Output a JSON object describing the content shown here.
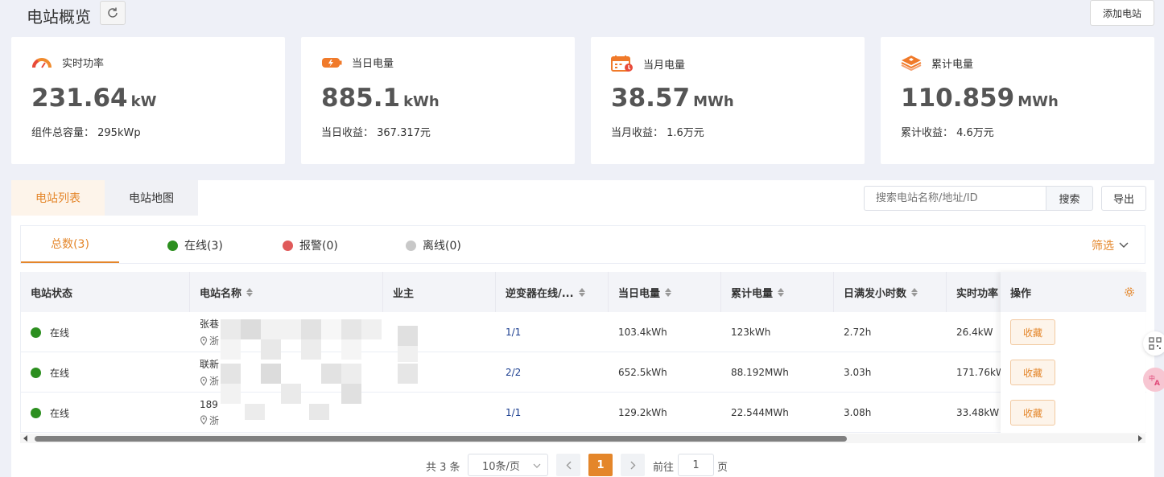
{
  "header": {
    "title": "电站概览",
    "add_station": "添加电站"
  },
  "cards": [
    {
      "label": "实时功率",
      "value": "231.64",
      "unit": "kW",
      "sub": "组件总容量： 295kWp",
      "icon": "speedometer-icon"
    },
    {
      "label": "当日电量",
      "value": "885.1",
      "unit": "kWh",
      "sub": "当日收益： 367.317元",
      "icon": "battery-bolt-icon"
    },
    {
      "label": "当月电量",
      "value": "38.57",
      "unit": "MWh",
      "sub": "当月收益： 1.6万元",
      "icon": "calendar-icon"
    },
    {
      "label": "累计电量",
      "value": "110.859",
      "unit": "MWh",
      "sub": "累计收益： 4.6万元",
      "icon": "layers-icon"
    }
  ],
  "tabs": {
    "list": "电站列表",
    "map": "电站地图"
  },
  "search": {
    "placeholder": "搜索电站名称/地址/ID",
    "button": "搜索",
    "export": "导出"
  },
  "filters": {
    "total": "总数(3)",
    "online": "在线(3)",
    "alarm": "报警(0)",
    "offline": "离线(0)",
    "screen": "筛选",
    "colors": {
      "online": "#2c8f1f",
      "alarm": "#e05a5a",
      "offline": "#c8c8c8"
    }
  },
  "table": {
    "headers": {
      "status": "电站状态",
      "name": "电站名称",
      "owner": "业主",
      "inverter": "逆变器在线/...",
      "daily": "当日电量",
      "total": "累计电量",
      "hours": "日满发小时数",
      "power": "实时功率",
      "action": "操作"
    },
    "rows": [
      {
        "status": "在线",
        "name": "张巷",
        "loc": "浙",
        "inverter": "1/1",
        "daily": "103.4kWh",
        "total": "123kWh",
        "hours": "2.72h",
        "power": "26.4kW",
        "action": "收藏"
      },
      {
        "status": "在线",
        "name": "联新",
        "loc": "浙",
        "inverter": "2/2",
        "daily": "652.5kWh",
        "total": "88.192MWh",
        "hours": "3.03h",
        "power": "171.76kW",
        "action": "收藏"
      },
      {
        "status": "在线",
        "name": "189",
        "loc": "浙",
        "inverter": "1/1",
        "daily": "129.2kWh",
        "total": "22.544MWh",
        "hours": "3.08h",
        "power": "33.48kW",
        "action": "收藏"
      }
    ]
  },
  "pager": {
    "total": "共 3 条",
    "size": "10条/页",
    "current": "1",
    "goto": "前往",
    "page_input": "1",
    "page_suffix": "页"
  },
  "accent": "#e4862a"
}
